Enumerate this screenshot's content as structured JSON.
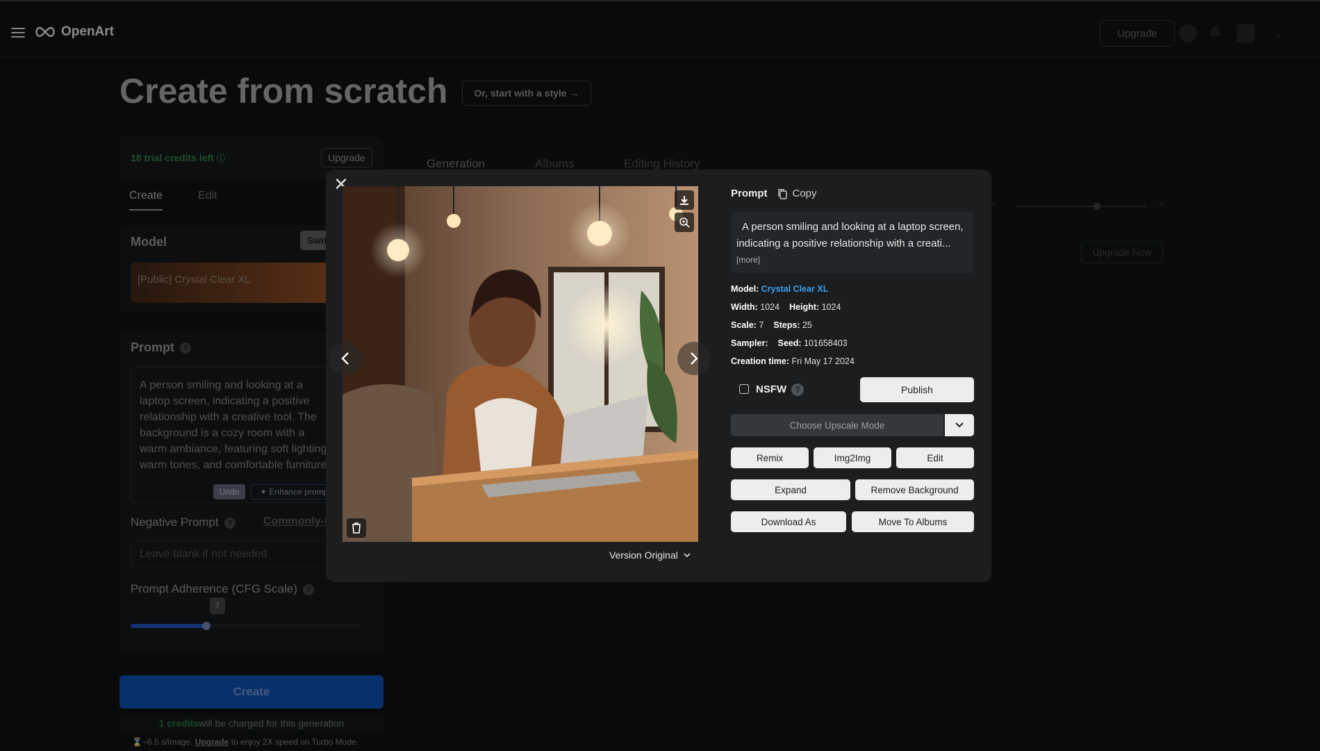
{
  "app": {
    "name": "OpenArt",
    "upgrade_label": "Upgrade"
  },
  "page": {
    "title": "Create from scratch",
    "style_button": "Or, start with a style →"
  },
  "sidebar": {
    "credits_text": "18 trial credits left",
    "credits_upgrade": "Upgrade",
    "tabs": [
      {
        "label": "Create"
      },
      {
        "label": "Edit"
      }
    ],
    "model_label": "Model",
    "switch_label": "Switch",
    "model_name": "[Public] Crystal Clear XL",
    "prompt_label": "Prompt",
    "prompt_text": "A person smiling and looking at a laptop screen, indicating a positive relationship with a creative tool. The background is a cozy room with a warm ambiance, featuring soft lighting, warm tones, and comfortable furniture",
    "undo_label": "Undo",
    "enhance_label": "Enhance prompt",
    "negative_label": "Negative Prompt",
    "commonly_label": "Commonly-used",
    "negative_placeholder": "Leave blank if not needed",
    "cfg_label": "Prompt Adherence (CFG Scale)",
    "cfg_value": "7",
    "cfg_fraction": 0.33,
    "create_label": "Create",
    "charge_bold": "1 credits",
    "charge_rest": " will be charged for this generation",
    "turbo_pre": "⌛~6.5 s/image. ",
    "turbo_link": "Upgrade",
    "turbo_post": " to enjoy 2X speed on Turbo Mode."
  },
  "results": {
    "tabs": [
      {
        "label": "Generation"
      },
      {
        "label": "Albums"
      },
      {
        "label": "Editing History"
      }
    ],
    "upgrade_now": "Upgrade Now"
  },
  "modal": {
    "prompt_header": "Prompt",
    "copy_label": "Copy",
    "prompt_excerpt": "A person smiling and looking at a laptop screen, indicating a positive relationship with a creati...",
    "more_label": "[more]",
    "model_key": "Model:",
    "model_value": "Crystal Clear XL",
    "width_key": "Width:",
    "width_value": "1024",
    "height_key": "Height:",
    "height_value": "1024",
    "scale_key": "Scale:",
    "scale_value": "7",
    "steps_key": "Steps:",
    "steps_value": "25",
    "sampler_key": "Sampler:",
    "seed_key": "Seed:",
    "seed_value": "101658403",
    "creation_key": "Creation time:",
    "creation_value": "Fri May 17 2024",
    "nsfw_label": "NSFW",
    "publish_label": "Publish",
    "upscale_label": "Choose Upscale Mode",
    "remix_label": "Remix",
    "img2img_label": "Img2Img",
    "edit_label": "Edit",
    "expand_label": "Expand",
    "remove_bg_label": "Remove Background",
    "download_as_label": "Download As",
    "move_albums_label": "Move To Albums",
    "version_label": "Version Original"
  },
  "colors": {
    "accent": "#3aa0f2",
    "create_blue": "#0b4ca5",
    "credits_green": "#2e7a45"
  }
}
